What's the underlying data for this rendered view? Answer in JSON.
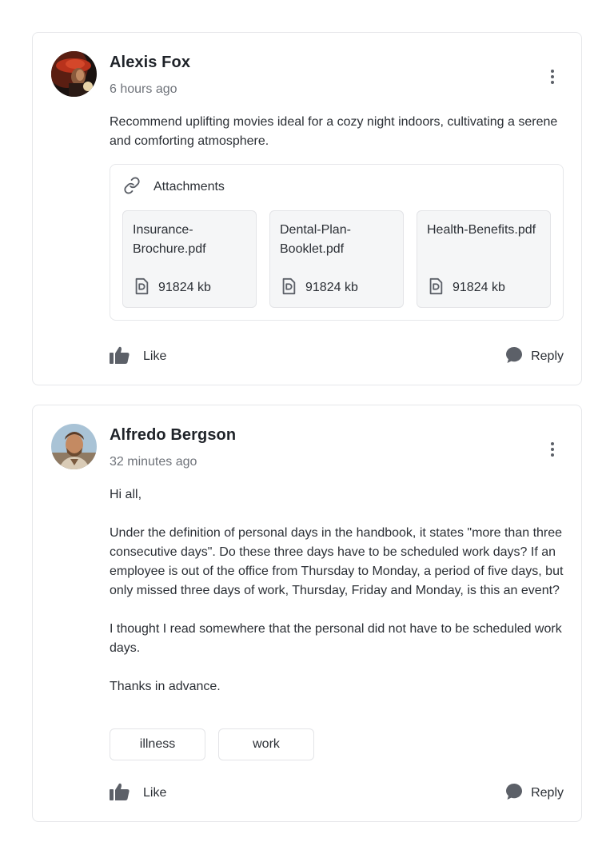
{
  "comments": [
    {
      "author": "Alexis Fox",
      "time": "6 hours ago",
      "body": [
        "Recommend uplifting movies ideal for a cozy night indoors, cultivating a serene and comforting atmosphere."
      ],
      "attachments": {
        "label": "Attachments",
        "files": [
          {
            "name": "Insurance-Brochure.pdf",
            "size": "91824 kb"
          },
          {
            "name": "Dental-Plan-Booklet.pdf",
            "size": "91824 kb"
          },
          {
            "name": "Health-Benefits.pdf",
            "size": "91824 kb"
          }
        ]
      },
      "like_label": "Like",
      "reply_label": "Reply"
    },
    {
      "author": "Alfredo Bergson",
      "time": "32 minutes ago",
      "body": [
        "Hi all,",
        "Under the definition of personal days in the handbook, it states \"more than three consecutive days\". Do these three days have to be scheduled work days? If an employee is out of the office from Thursday to Monday, a period of five days, but only missed three days of work, Thursday, Friday and Monday, is this an event?",
        "I thought I read somewhere that the personal did not have to be scheduled work days.",
        "Thanks in advance."
      ],
      "tags": [
        "illness",
        "work"
      ],
      "like_label": "Like",
      "reply_label": "Reply"
    }
  ],
  "colors": {
    "border": "#e6e7ea",
    "text": "#2b2f35",
    "muted": "#6f737a",
    "icon": "#5c6068",
    "file_bg": "#f5f6f7"
  },
  "icons": {
    "menu": "more-vertical-icon",
    "attachment": "link-icon",
    "file": "document-icon",
    "like": "thumbs-up-icon",
    "reply": "chat-bubble-icon"
  }
}
